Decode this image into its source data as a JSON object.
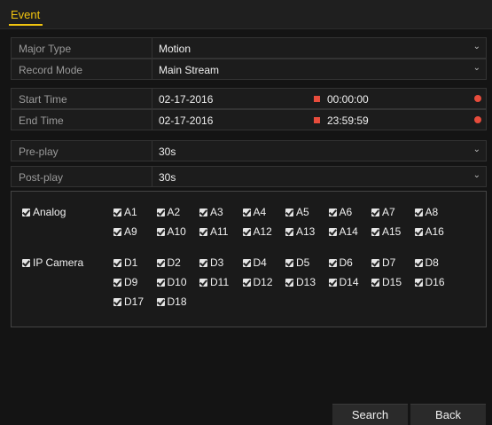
{
  "tab": {
    "label": "Event"
  },
  "fields": {
    "major_type": {
      "label": "Major Type",
      "value": "Motion"
    },
    "record_mode": {
      "label": "Record Mode",
      "value": "Main Stream"
    },
    "start_time": {
      "label": "Start Time",
      "date": "02-17-2016",
      "time": "00:00:00"
    },
    "end_time": {
      "label": "End Time",
      "date": "02-17-2016",
      "time": "23:59:59"
    },
    "pre_play": {
      "label": "Pre-play",
      "value": "30s"
    },
    "post_play": {
      "label": "Post-play",
      "value": "30s"
    }
  },
  "channels": {
    "analog": {
      "label": "Analog",
      "items": [
        "A1",
        "A2",
        "A3",
        "A4",
        "A5",
        "A6",
        "A7",
        "A8",
        "A9",
        "A10",
        "A11",
        "A12",
        "A13",
        "A14",
        "A15",
        "A16"
      ]
    },
    "ip_camera": {
      "label": "IP Camera",
      "items": [
        "D1",
        "D2",
        "D3",
        "D4",
        "D5",
        "D6",
        "D7",
        "D8",
        "D9",
        "D10",
        "D11",
        "D12",
        "D13",
        "D14",
        "D15",
        "D16",
        "D17",
        "D18"
      ]
    }
  },
  "buttons": {
    "search": "Search",
    "back": "Back"
  },
  "colors": {
    "accent": "#f1c40f",
    "icon_red": "#e74c3c"
  }
}
